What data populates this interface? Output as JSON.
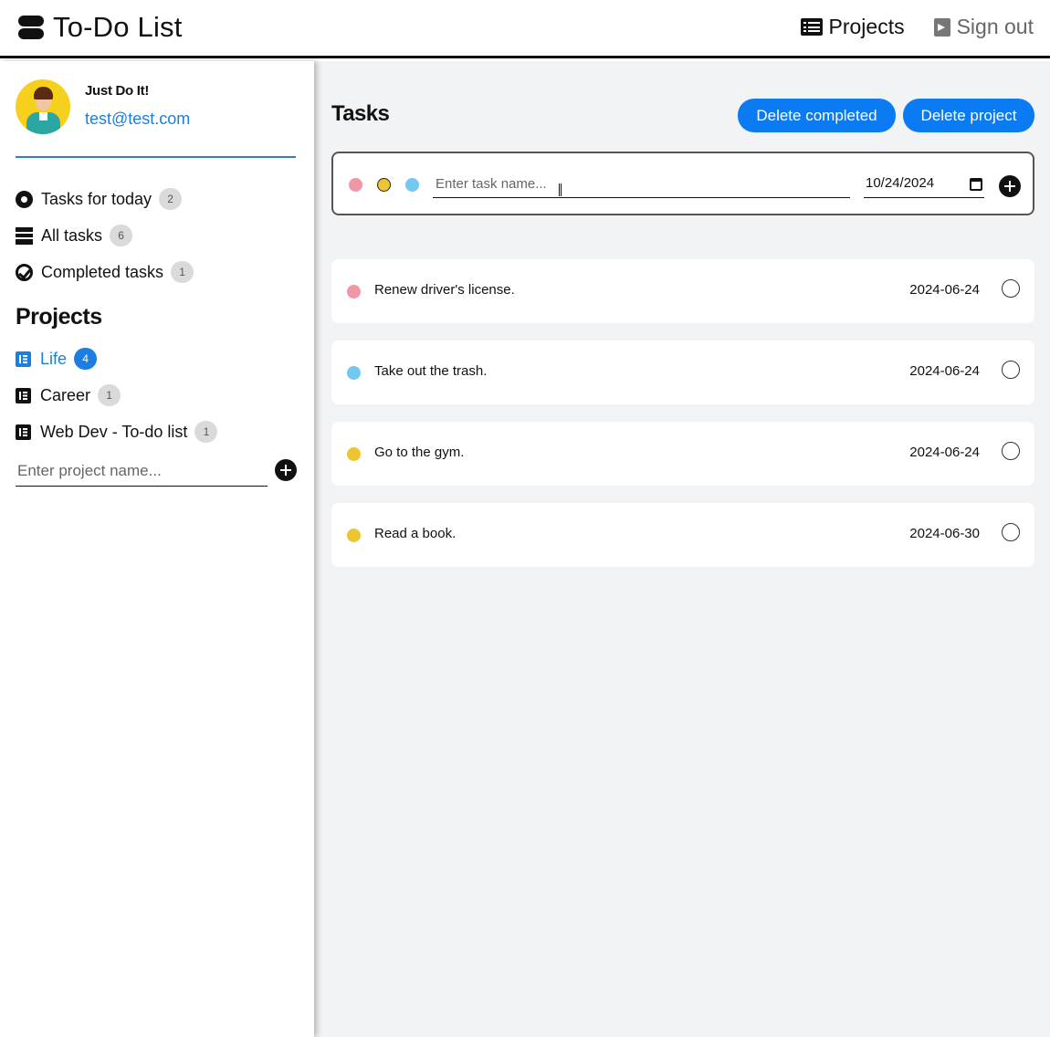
{
  "header": {
    "title": "To-Do List",
    "nav": {
      "projects_label": "Projects",
      "signout_label": "Sign out"
    }
  },
  "profile": {
    "name": "Just Do It!",
    "email": "test@test.com"
  },
  "menu": {
    "items": [
      {
        "label": "Tasks for today",
        "count": "2",
        "icon": "circle-dot-icon"
      },
      {
        "label": "All tasks",
        "count": "6",
        "icon": "list-lines-icon"
      },
      {
        "label": "Completed tasks",
        "count": "1",
        "icon": "check-circle-icon"
      }
    ]
  },
  "projects": {
    "title": "Projects",
    "items": [
      {
        "label": "Life",
        "count": "4",
        "active": true
      },
      {
        "label": "Career",
        "count": "1",
        "active": false
      },
      {
        "label": "Web Dev - To-do list",
        "count": "1",
        "active": false
      }
    ],
    "input_placeholder": "Enter project name..."
  },
  "main": {
    "title": "Tasks",
    "delete_completed_label": "Delete completed",
    "delete_project_label": "Delete project",
    "new_task": {
      "placeholder": "Enter task name...",
      "date_value": "10/24/2024",
      "priority_colors": [
        "#ef97a6",
        "#ecc531",
        "#70c9f1"
      ],
      "selected_priority": "yellow"
    },
    "tasks": [
      {
        "name": "Renew driver's license.",
        "date": "2024-06-24",
        "color": "#ef97a6"
      },
      {
        "name": "Take out the trash.",
        "date": "2024-06-24",
        "color": "#70c9f1"
      },
      {
        "name": "Go to the gym.",
        "date": "2024-06-24",
        "color": "#ecc531"
      },
      {
        "name": "Read a book.",
        "date": "2024-06-30",
        "color": "#ecc531"
      }
    ]
  },
  "colors": {
    "accent": "#0a7bf2",
    "link": "#1a7fe0",
    "background_main": "#f2f3f5"
  }
}
